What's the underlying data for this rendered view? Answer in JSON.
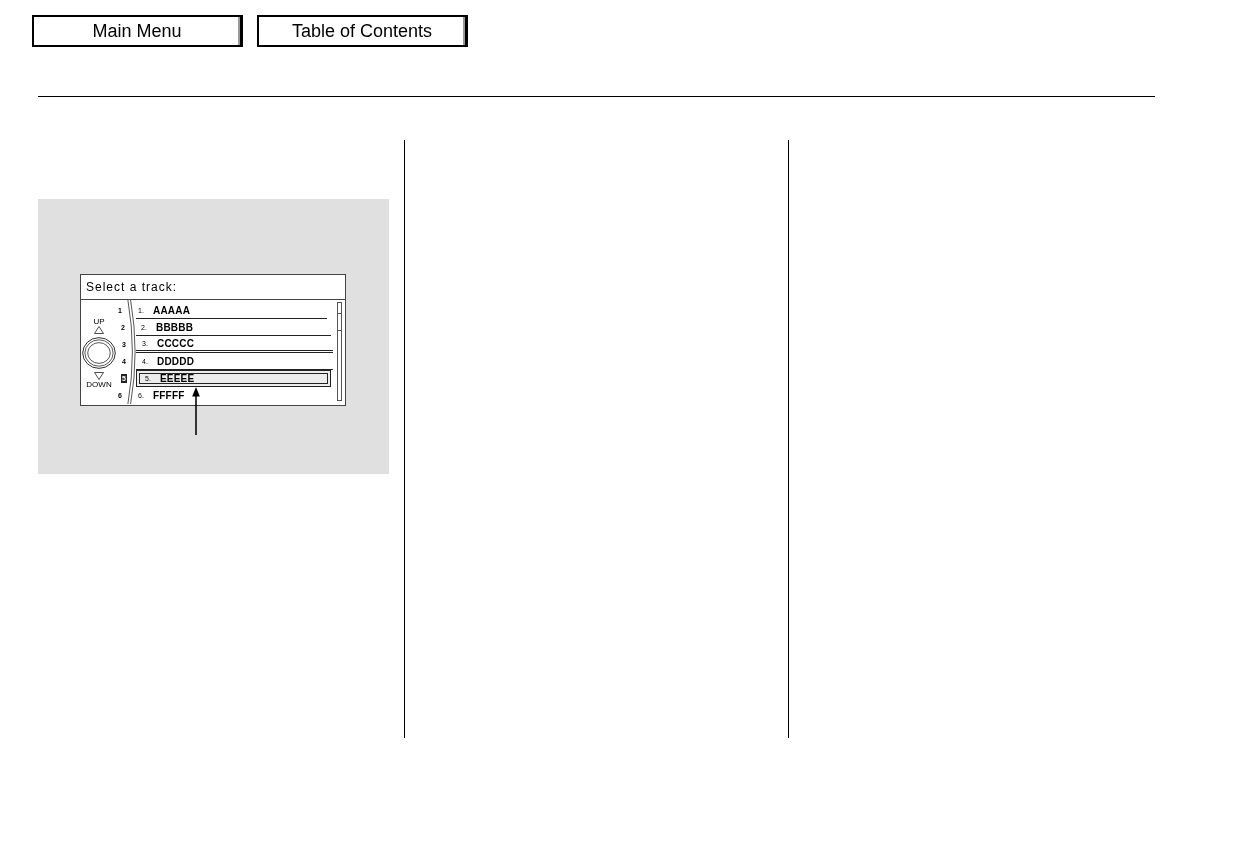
{
  "nav_buttons": [
    {
      "label": "Main Menu"
    },
    {
      "label": "Table of Contents"
    }
  ],
  "figure": {
    "screen": {
      "title": "Select a track:",
      "up_label": "UP",
      "down_label": "DOWN",
      "presets": [
        {
          "label": "1",
          "selected": false
        },
        {
          "label": "2",
          "selected": false
        },
        {
          "label": "3",
          "selected": false
        },
        {
          "label": "4",
          "selected": false
        },
        {
          "label": "5",
          "selected": true
        },
        {
          "label": "6",
          "selected": false
        }
      ],
      "tracks": [
        {
          "number": "1.",
          "name": "AAAAA",
          "selected": false,
          "separator": false
        },
        {
          "number": "2.",
          "name": "BBBBB",
          "selected": false,
          "separator": false
        },
        {
          "number": "3.",
          "name": "CCCCC",
          "selected": false,
          "separator": true
        },
        {
          "number": "4.",
          "name": "DDDDD",
          "selected": false,
          "separator": false
        },
        {
          "number": "5.",
          "name": "EEEEE",
          "selected": true,
          "separator": false
        },
        {
          "number": "6.",
          "name": "FFFFF",
          "selected": false,
          "separator": false
        }
      ]
    }
  }
}
